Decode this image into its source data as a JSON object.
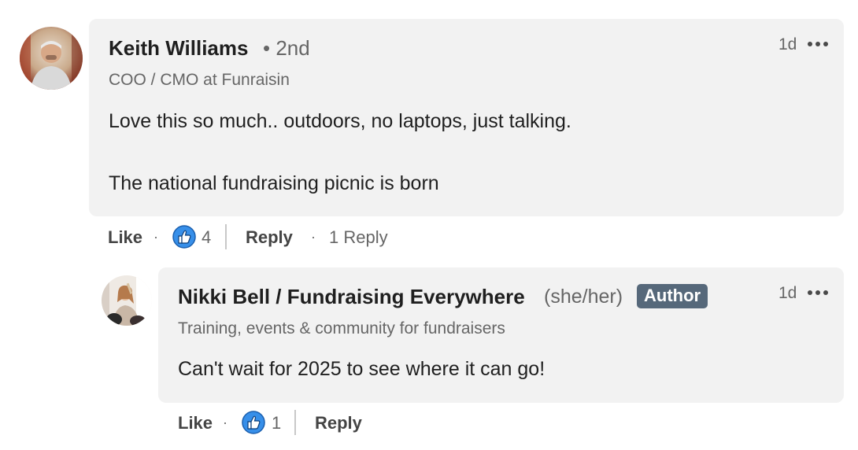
{
  "comments": [
    {
      "author": "Keith Williams",
      "connection_degree": "• 2nd",
      "headline": "COO / CMO at Funraisin",
      "text_lines": [
        "Love this so much.. outdoors, no laptops, just talking.",
        "The national fundraising picnic is born"
      ],
      "timestamp": "1d",
      "actions": {
        "like_label": "Like",
        "reaction_count": "4",
        "reply_label": "Reply",
        "replies_count_label": "1 Reply"
      }
    }
  ],
  "reply": {
    "author": "Nikki Bell / Fundraising Everywhere",
    "pronouns": "(she/her)",
    "badge": "Author",
    "headline": "Training, events & community for fundraisers",
    "text": "Can't wait for 2025 to see where it can go!",
    "timestamp": "1d",
    "actions": {
      "like_label": "Like",
      "reaction_count": "1",
      "reply_label": "Reply"
    }
  },
  "icons": {
    "reaction": "like-thumbs-up-icon",
    "overflow": "more-options-icon"
  },
  "colors": {
    "bubble_bg": "#f2f2f2",
    "like_blue": "#378fe9",
    "badge_bg": "#56687a"
  }
}
